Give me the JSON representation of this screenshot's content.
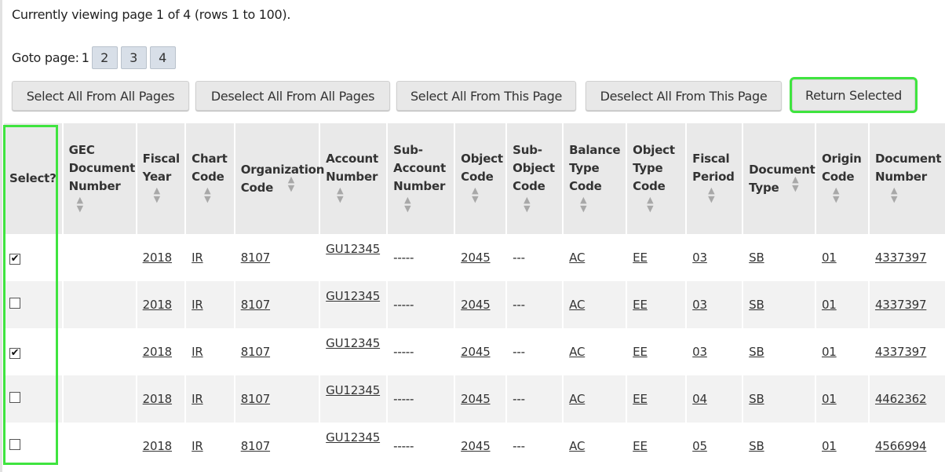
{
  "status": {
    "text": "Currently viewing page 1 of 4 (rows 1 to 100)."
  },
  "paging": {
    "label": "Goto page:",
    "current": "1",
    "pages": [
      "2",
      "3",
      "4"
    ]
  },
  "buttons": {
    "select_all_pages": "Select All From All Pages",
    "deselect_all_pages": "Deselect All From All Pages",
    "select_all_this": "Select All From This Page",
    "deselect_all_this": "Deselect All From This Page",
    "return_selected": "Return Selected"
  },
  "columns": [
    "Select?",
    "GEC Document Number",
    "Fiscal Year",
    "Chart Code",
    "Organization Code",
    "Account Number",
    "Sub-Account Number",
    "Object Code",
    "Sub-Object Code",
    "Balance Type Code",
    "Object Type Code",
    "Fiscal Period",
    "Document Type",
    "Origin Code",
    "Document Number"
  ],
  "sort_icon": "sort-updown-icon",
  "highlight_color": "#3fe43f",
  "rows": [
    {
      "checked": true,
      "gec": "",
      "fiscal_year": "2018",
      "chart": "IR",
      "org": "8107",
      "account": "GU12345",
      "sub_account": "-----",
      "object": "2045",
      "sub_object": "---",
      "balance_type": "AC",
      "object_type": "EE",
      "period": "03",
      "doc_type": "SB",
      "origin": "01",
      "doc_number": "4337397"
    },
    {
      "checked": false,
      "gec": "",
      "fiscal_year": "2018",
      "chart": "IR",
      "org": "8107",
      "account": "GU12345",
      "sub_account": "-----",
      "object": "2045",
      "sub_object": "---",
      "balance_type": "AC",
      "object_type": "EE",
      "period": "03",
      "doc_type": "SB",
      "origin": "01",
      "doc_number": "4337397"
    },
    {
      "checked": true,
      "gec": "",
      "fiscal_year": "2018",
      "chart": "IR",
      "org": "8107",
      "account": "GU12345",
      "sub_account": "-----",
      "object": "2045",
      "sub_object": "---",
      "balance_type": "AC",
      "object_type": "EE",
      "period": "03",
      "doc_type": "SB",
      "origin": "01",
      "doc_number": "4337397"
    },
    {
      "checked": false,
      "gec": "",
      "fiscal_year": "2018",
      "chart": "IR",
      "org": "8107",
      "account": "GU12345",
      "sub_account": "-----",
      "object": "2045",
      "sub_object": "---",
      "balance_type": "AC",
      "object_type": "EE",
      "period": "04",
      "doc_type": "SB",
      "origin": "01",
      "doc_number": "4462362"
    },
    {
      "checked": false,
      "gec": "",
      "fiscal_year": "2018",
      "chart": "IR",
      "org": "8107",
      "account": "GU12345",
      "sub_account": "-----",
      "object": "2045",
      "sub_object": "---",
      "balance_type": "AC",
      "object_type": "EE",
      "period": "05",
      "doc_type": "SB",
      "origin": "01",
      "doc_number": "4566994"
    }
  ]
}
